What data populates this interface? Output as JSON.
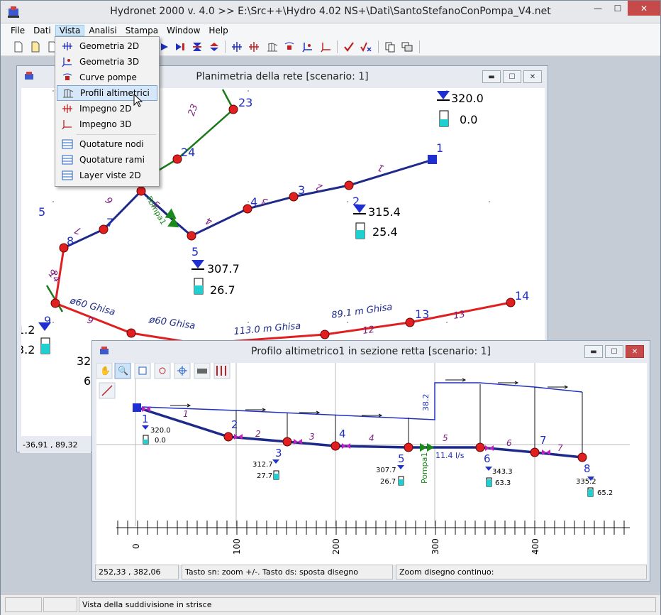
{
  "app": {
    "title": "Hydronet 2000 v. 4.0 >> E:\\Src++\\Hydro 4.02 NS+\\Dati\\SantoStefanoConPompa_V4.net",
    "window_buttons": {
      "minimize": "—",
      "maximize": "☐",
      "close": "✕"
    }
  },
  "menubar": [
    "File",
    "Dati",
    "Vista",
    "Analisi",
    "Stampa",
    "Window",
    "Help"
  ],
  "vista_menu": {
    "items": [
      {
        "label": "Geometria 2D",
        "icon": "geometry-2d-icon"
      },
      {
        "label": "Geometria 3D",
        "icon": "geometry-3d-icon"
      },
      {
        "label": "Curve pompe",
        "icon": "pump-curve-icon"
      },
      {
        "label": "Profili altimetrici",
        "icon": "profile-icon",
        "highlighted": true
      },
      {
        "label": "Impegno 2D",
        "icon": "impegno-2d-icon"
      },
      {
        "label": "Impegno 3D",
        "icon": "impegno-3d-icon"
      },
      {
        "label": "Quotature nodi",
        "icon": "table-icon"
      },
      {
        "label": "Quotature rami",
        "icon": "table-icon"
      },
      {
        "label": "Layer viste 2D",
        "icon": "table-icon"
      }
    ]
  },
  "planimetria": {
    "title": "Planimetria della rete [scenario: 1]",
    "coords": "-36,91 , 89,32",
    "nodes": [
      "1",
      "2",
      "3",
      "4",
      "5",
      "6",
      "7",
      "8",
      "9",
      "10",
      "13",
      "14",
      "23",
      "24"
    ],
    "node_values": {
      "n1": {
        "head": "320.0",
        "pressure": "0.0"
      },
      "n2": {
        "head": "315.4",
        "pressure": "25.4"
      },
      "n5": {
        "head": "307.7",
        "pressure": "26.7"
      },
      "n9": {
        "head": "1.2",
        "pressure": "3.2"
      },
      "cut": {
        "head": "32",
        "pressure": "6"
      }
    },
    "pipe_labels": [
      "1",
      "2",
      "3",
      "4",
      "5",
      "6",
      "7",
      "8",
      "9",
      "12",
      "13",
      "14",
      "23"
    ],
    "pipe_texts": [
      "ø60  Ghisa",
      "ø60  Ghisa",
      "113.0 m Ghisa",
      "89.1 m Ghisa"
    ],
    "pump_label": "Pompa1",
    "left_node_5": "5"
  },
  "profilo": {
    "title": "Profilo altimetrico1 in sezione retta [scenario: 1]",
    "status_coords": "252,33 , 382,06",
    "status_hint": "Tasto sn: zoom +/-. Tasto ds: sposta disegno",
    "status_zoom": "Zoom disegno continuo:",
    "nodes": [
      "1",
      "2",
      "3",
      "4",
      "5",
      "6",
      "7",
      "8"
    ],
    "pipes": [
      "1",
      "2",
      "3",
      "4",
      "5",
      "6",
      "7"
    ],
    "node_values": [
      {
        "node": "1",
        "head": "320.0",
        "pressure": "0.0"
      },
      {
        "node": "3",
        "head": "312.7",
        "pressure": "27.7"
      },
      {
        "node": "5",
        "head": "307.7",
        "pressure": "26.7"
      },
      {
        "node": "6",
        "head": "343.3",
        "pressure": "63.3"
      },
      {
        "node": "8",
        "head": "335.2",
        "pressure": "65.2"
      }
    ],
    "pump_label": "Pompa1",
    "flow_label": "11.4 l/s",
    "head_gain_label": "38.2",
    "axis_labels": [
      "0",
      "100",
      "200",
      "300",
      "400"
    ]
  },
  "statusbar": {
    "message": "Vista della suddivisione in strisce"
  }
}
